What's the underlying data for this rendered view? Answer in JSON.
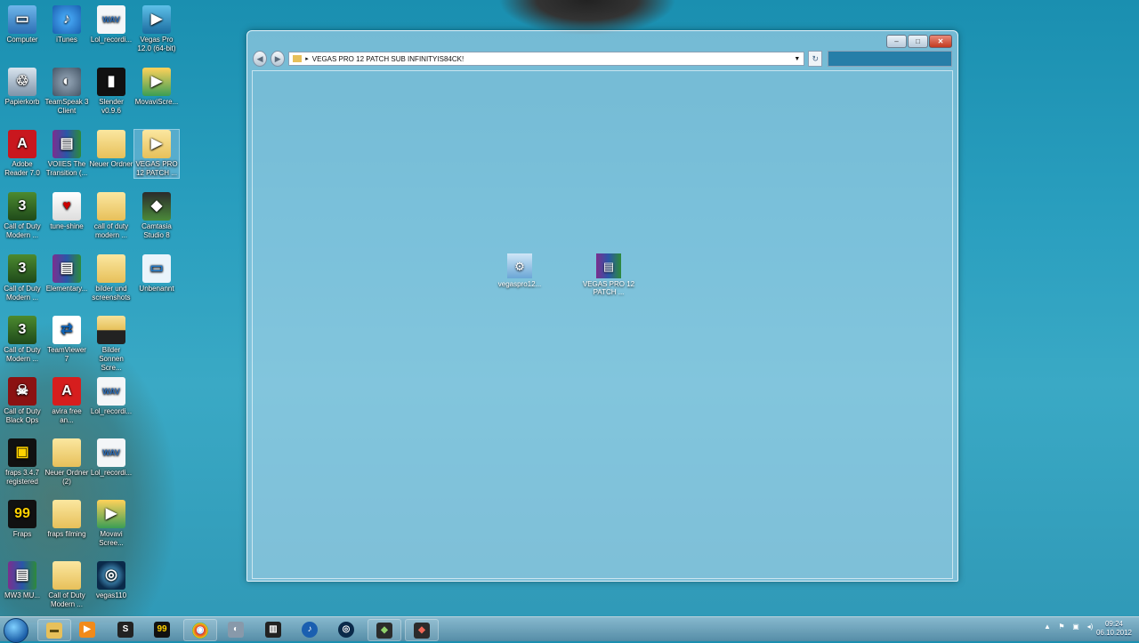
{
  "desktop": {
    "icons": [
      {
        "label": "Computer"
      },
      {
        "label": "iTunes"
      },
      {
        "label": "Lol_recordi..."
      },
      {
        "label": "Vegas Pro 12.0 (64-bit)"
      },
      {
        "label": "Papierkorb"
      },
      {
        "label": "TeamSpeak 3 Client"
      },
      {
        "label": "Slender v0.9.6"
      },
      {
        "label": "MovaviScre..."
      },
      {
        "label": "Adobe Reader 7.0"
      },
      {
        "label": "VOIIES The Transition (..."
      },
      {
        "label": "Neuer Ordner"
      },
      {
        "label": "VEGAS PRO 12 PATCH ..."
      },
      {
        "label": "Call of Duty Modern ..."
      },
      {
        "label": "tune-shine"
      },
      {
        "label": "call of duty modern ..."
      },
      {
        "label": "Camtasia Studio 8"
      },
      {
        "label": "Call of Duty Modern ..."
      },
      {
        "label": "Elementary..."
      },
      {
        "label": "bilder und screenshots"
      },
      {
        "label": "Unbenannt"
      },
      {
        "label": "Call of Duty Modern ..."
      },
      {
        "label": "TeamViewer 7"
      },
      {
        "label": "Bilder Sonnen Scre..."
      },
      {
        "label": "Call of Duty Black Ops"
      },
      {
        "label": "avira free an..."
      },
      {
        "label": "Lol_recordi..."
      },
      {
        "label": "fraps 3.4.7 registered"
      },
      {
        "label": "Neuer Ordner (2)"
      },
      {
        "label": "Lol_recordi..."
      },
      {
        "label": "Fraps"
      },
      {
        "label": "fraps filming"
      },
      {
        "label": "Movavi Scree..."
      },
      {
        "label": "MW3 MU..."
      },
      {
        "label": "Call of Duty Modern ..."
      },
      {
        "label": "vegas110"
      }
    ]
  },
  "window": {
    "address": "VEGAS PRO 12 PATCH SUB INFINITYIS84CK!",
    "search_placeholder": "",
    "controls": {
      "minimize": "–",
      "maximize": "□",
      "close": "✕"
    },
    "nav": {
      "back": "◀",
      "forward": "▶",
      "refresh": "↻"
    },
    "items": [
      {
        "label": "vegaspro12..."
      },
      {
        "label": "VEGAS PRO 12 PATCH ..."
      }
    ]
  },
  "taskbar": {
    "clock_time": "09:24",
    "clock_date": "06.10.2012",
    "items": [
      {
        "name": "explorer",
        "glyph": "▬"
      },
      {
        "name": "media-player",
        "glyph": "▶"
      },
      {
        "name": "steam",
        "glyph": "S"
      },
      {
        "name": "fraps",
        "glyph": "99"
      },
      {
        "name": "chrome",
        "glyph": "◉"
      },
      {
        "name": "teamspeak",
        "glyph": "◐"
      },
      {
        "name": "winamp",
        "glyph": "▥"
      },
      {
        "name": "itunes",
        "glyph": "♪"
      },
      {
        "name": "vegas",
        "glyph": "◎"
      },
      {
        "name": "camtasia",
        "glyph": "◆"
      },
      {
        "name": "camtasia-recorder",
        "glyph": "◆"
      }
    ],
    "tray": [
      "▲",
      "⚑",
      "▣",
      "◂)"
    ]
  },
  "colors": {
    "accent": "#2a9fbf",
    "taskbar": "#7ab0c8",
    "close": "#c33a20"
  }
}
